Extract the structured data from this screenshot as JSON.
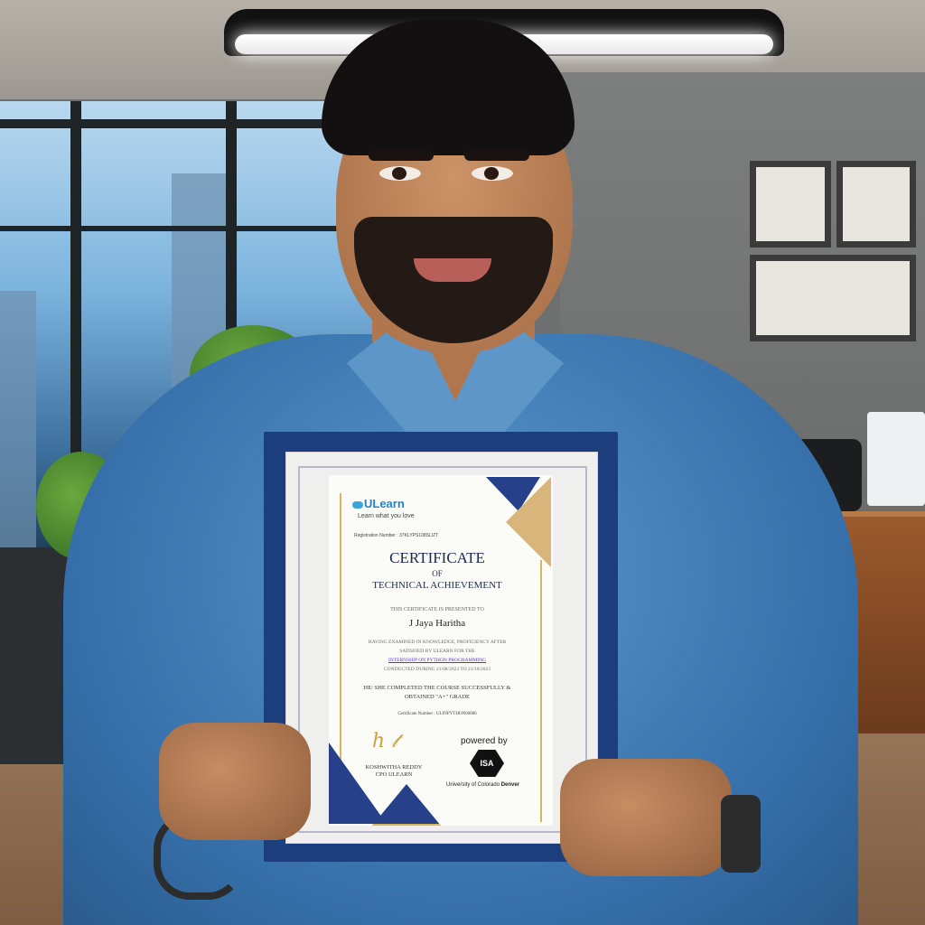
{
  "certificate": {
    "logo_text": "ULearn",
    "tagline": "Learn what you love",
    "registration": "Registration Number : 37KLYPS108SLIZT",
    "title_main": "CERTIFICATE",
    "title_of": "OF",
    "title_sub": "TECHNICAL ACHIEVEMENT",
    "presented_to": "THIS CERTIFICATE IS PRESENTED TO",
    "recipient": "J Jaya Haritha",
    "body_line1": "HAVING EXAMINED IN KNOWLEDGE, PROFICIENCY AFTER",
    "body_line2": "SATISFIED BY ULEARN FOR THE",
    "course": "INTERNSHIP ON PYTHON PROGRAMMING",
    "body_line3": "CONDUCTED DURING 21/08/2023 TO 21/10/2023",
    "completion_line1": "HE/ SHE COMPLETED THE COURSE SUCCESSFULLY &",
    "completion_line2": "OBTAINED \"A+\" GRADE",
    "certificate_number": "Certificate Number : ULINPYTHON00086",
    "signatory_name": "KOSHWITHA REDDY",
    "signatory_title": "CPO ULEARN",
    "powered_by": "powered by",
    "partner_logo": "ISA",
    "university": "University of Colorado ",
    "university_bold": "Denver"
  },
  "colors": {
    "frame_navy": "#1c3e7c",
    "accent_gold": "#d9b45a",
    "shirt_blue": "#4a86c0"
  }
}
